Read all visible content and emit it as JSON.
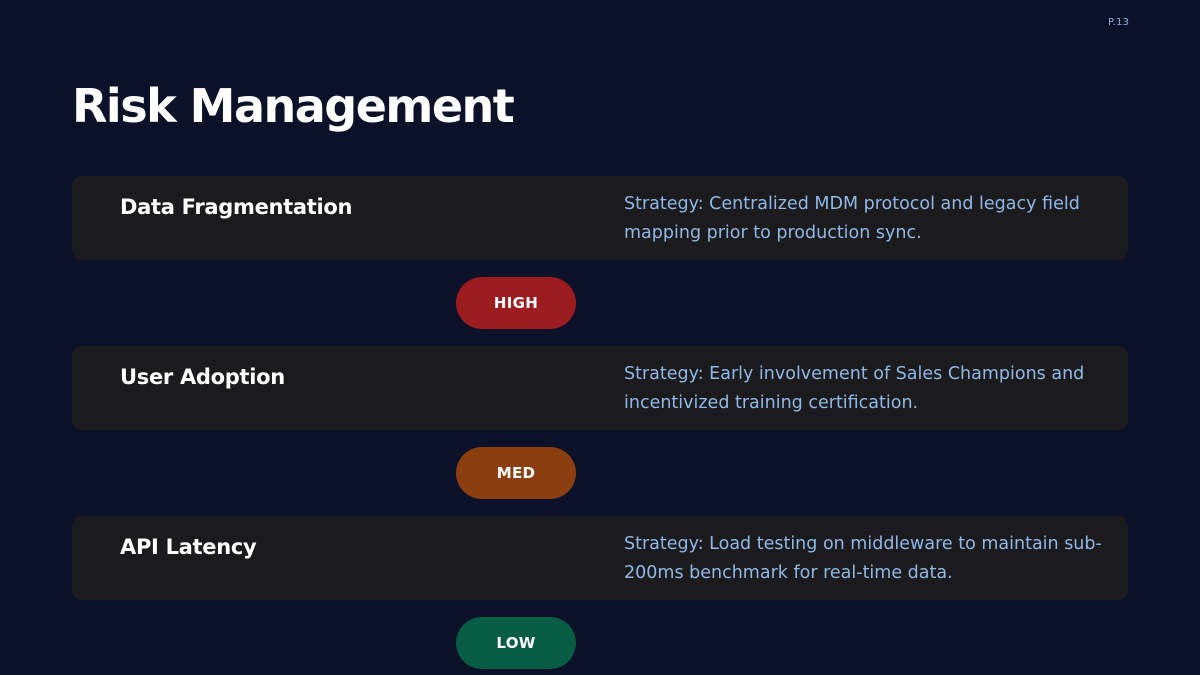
{
  "page": {
    "number": "P.13",
    "title": "Risk Management"
  },
  "colors": {
    "background": "#0a1128",
    "card": "#1b1b1d",
    "strategy_text": "#8fb9e8",
    "high": "#9c1c1f",
    "med": "#8b3f10",
    "low": "#0a5d45"
  },
  "risks": [
    {
      "name": "Data Fragmentation",
      "strategy": "Strategy: Centralized MDM protocol and legacy field mapping prior to production sync.",
      "severity": "HIGH"
    },
    {
      "name": "User Adoption",
      "strategy": "Strategy: Early involvement of Sales Champions and incentivized training certification.",
      "severity": "MED"
    },
    {
      "name": "API Latency",
      "strategy": "Strategy: Load testing on middleware to maintain sub-200ms benchmark for real-time data.",
      "severity": "LOW"
    }
  ]
}
